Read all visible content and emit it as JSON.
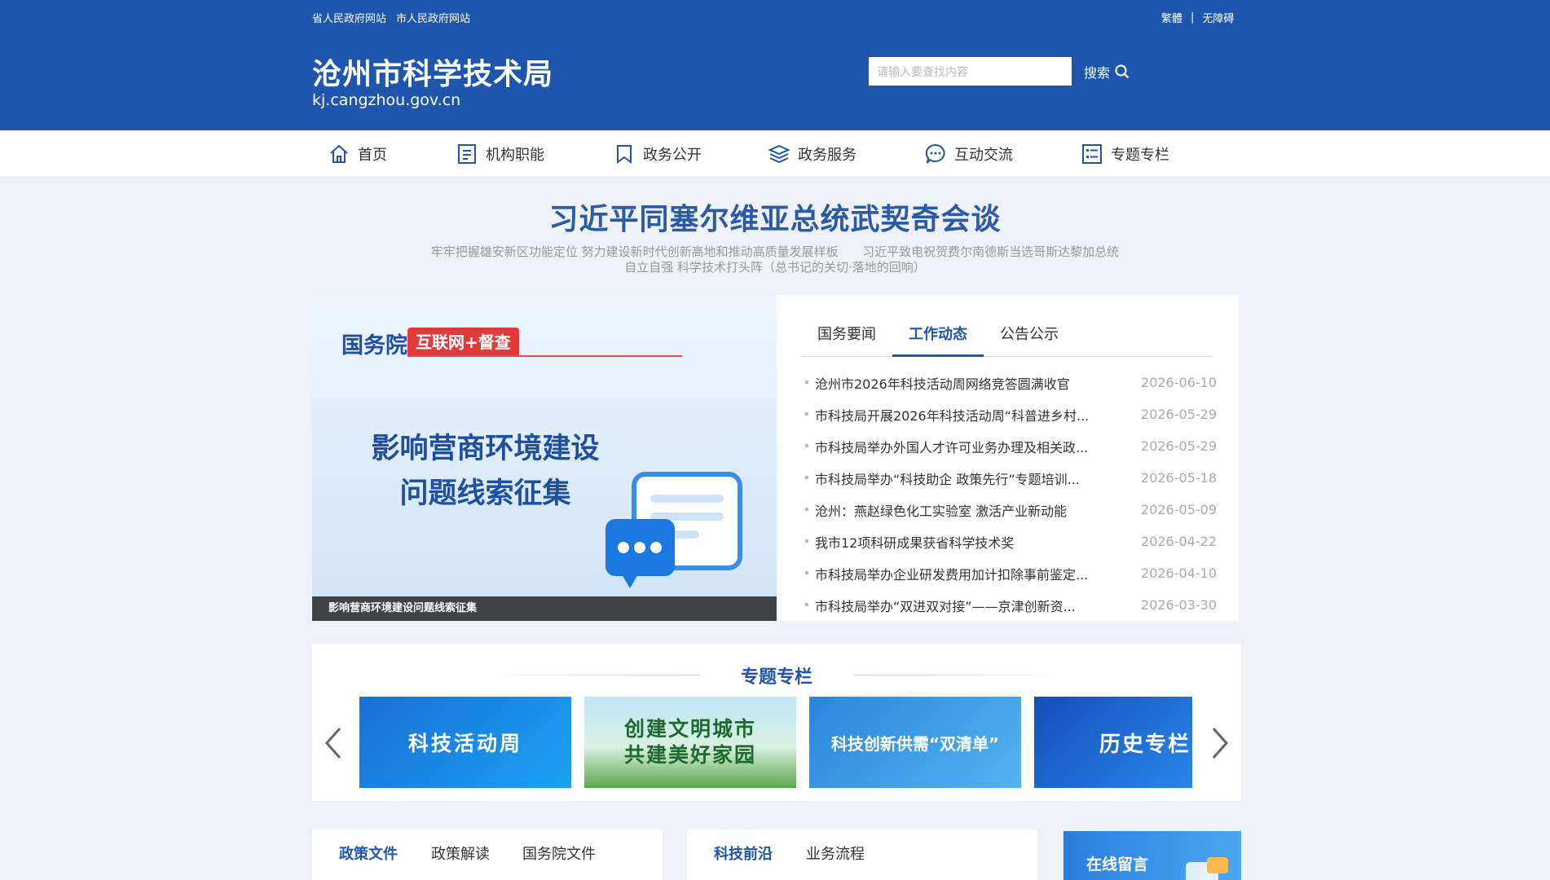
{
  "header": {
    "top_left_links": [
      "省人民政府网站",
      "市人民政府网站"
    ],
    "top_right_links": [
      "繁體",
      "无障碍"
    ],
    "top_right_separator": "|",
    "title": "沧州市科学技术局",
    "domain": "kj.cangzhou.gov.cn",
    "search_placeholder": "请输入要查找内容",
    "search_button": "搜索"
  },
  "nav": [
    {
      "label": "首页",
      "icon": "home-icon"
    },
    {
      "label": "机构职能",
      "icon": "document-icon"
    },
    {
      "label": "政务公开",
      "icon": "bookmark-icon"
    },
    {
      "label": "政务服务",
      "icon": "layers-icon"
    },
    {
      "label": "互动交流",
      "icon": "chat-icon"
    },
    {
      "label": "专题专栏",
      "icon": "list-icon"
    }
  ],
  "headline": {
    "title": "习近平同塞尔维亚总统武契奇会谈",
    "sub_1a": "牢牢把握雄安新区功能定位 努力建设新时代创新高地和推动高质量发展样板",
    "sub_1b": "习近平致电祝贺费尔南德斯当选哥斯达黎加总统",
    "sub_2": "自立自强 科学技术打头阵（总书记的关切·落地的回响）"
  },
  "slide": {
    "brand": "国务院",
    "badge": "互联网+督查",
    "line1": "影响营商环境建设",
    "line2": "问题线索征集",
    "caption": "影响营商环境建设问题线索征集"
  },
  "news": {
    "tabs": [
      "国务要闻",
      "工作动态",
      "公告公示"
    ],
    "active_tab": 1,
    "items": [
      {
        "title": "沧州市2026年科技活动周网络竞答圆满收官",
        "date": "2026-06-10"
      },
      {
        "title": "市科技局开展2026年科技活动周“科普进乡村...",
        "date": "2026-05-29"
      },
      {
        "title": "市科技局举办外国人才许可业务办理及相关政...",
        "date": "2026-05-29"
      },
      {
        "title": "市科技局举办“科技助企 政策先行”专题培训...",
        "date": "2026-05-18"
      },
      {
        "title": "沧州：燕赵绿色化工实验室 激活产业新动能",
        "date": "2026-05-09"
      },
      {
        "title": "我市12项科研成果获省科学技术奖",
        "date": "2026-04-22"
      },
      {
        "title": "市科技局举办企业研发费用加计扣除事前鉴定...",
        "date": "2026-04-10"
      },
      {
        "title": "市科技局举办“双进双对接”——京津创新资...",
        "date": "2026-03-30"
      }
    ]
  },
  "topic": {
    "title": "专题专栏",
    "banners": [
      {
        "label": "科技活动周"
      },
      {
        "label": "创建文明城市",
        "label2": "共建美好家园"
      },
      {
        "label": "科技创新供需“双清单”"
      },
      {
        "label": "历史专栏"
      }
    ]
  },
  "lower": {
    "left_tabs": [
      "政策文件",
      "政策解读",
      "国务院文件"
    ],
    "mid_tabs": [
      "科技前沿",
      "业务流程"
    ],
    "message": "在线留言"
  }
}
